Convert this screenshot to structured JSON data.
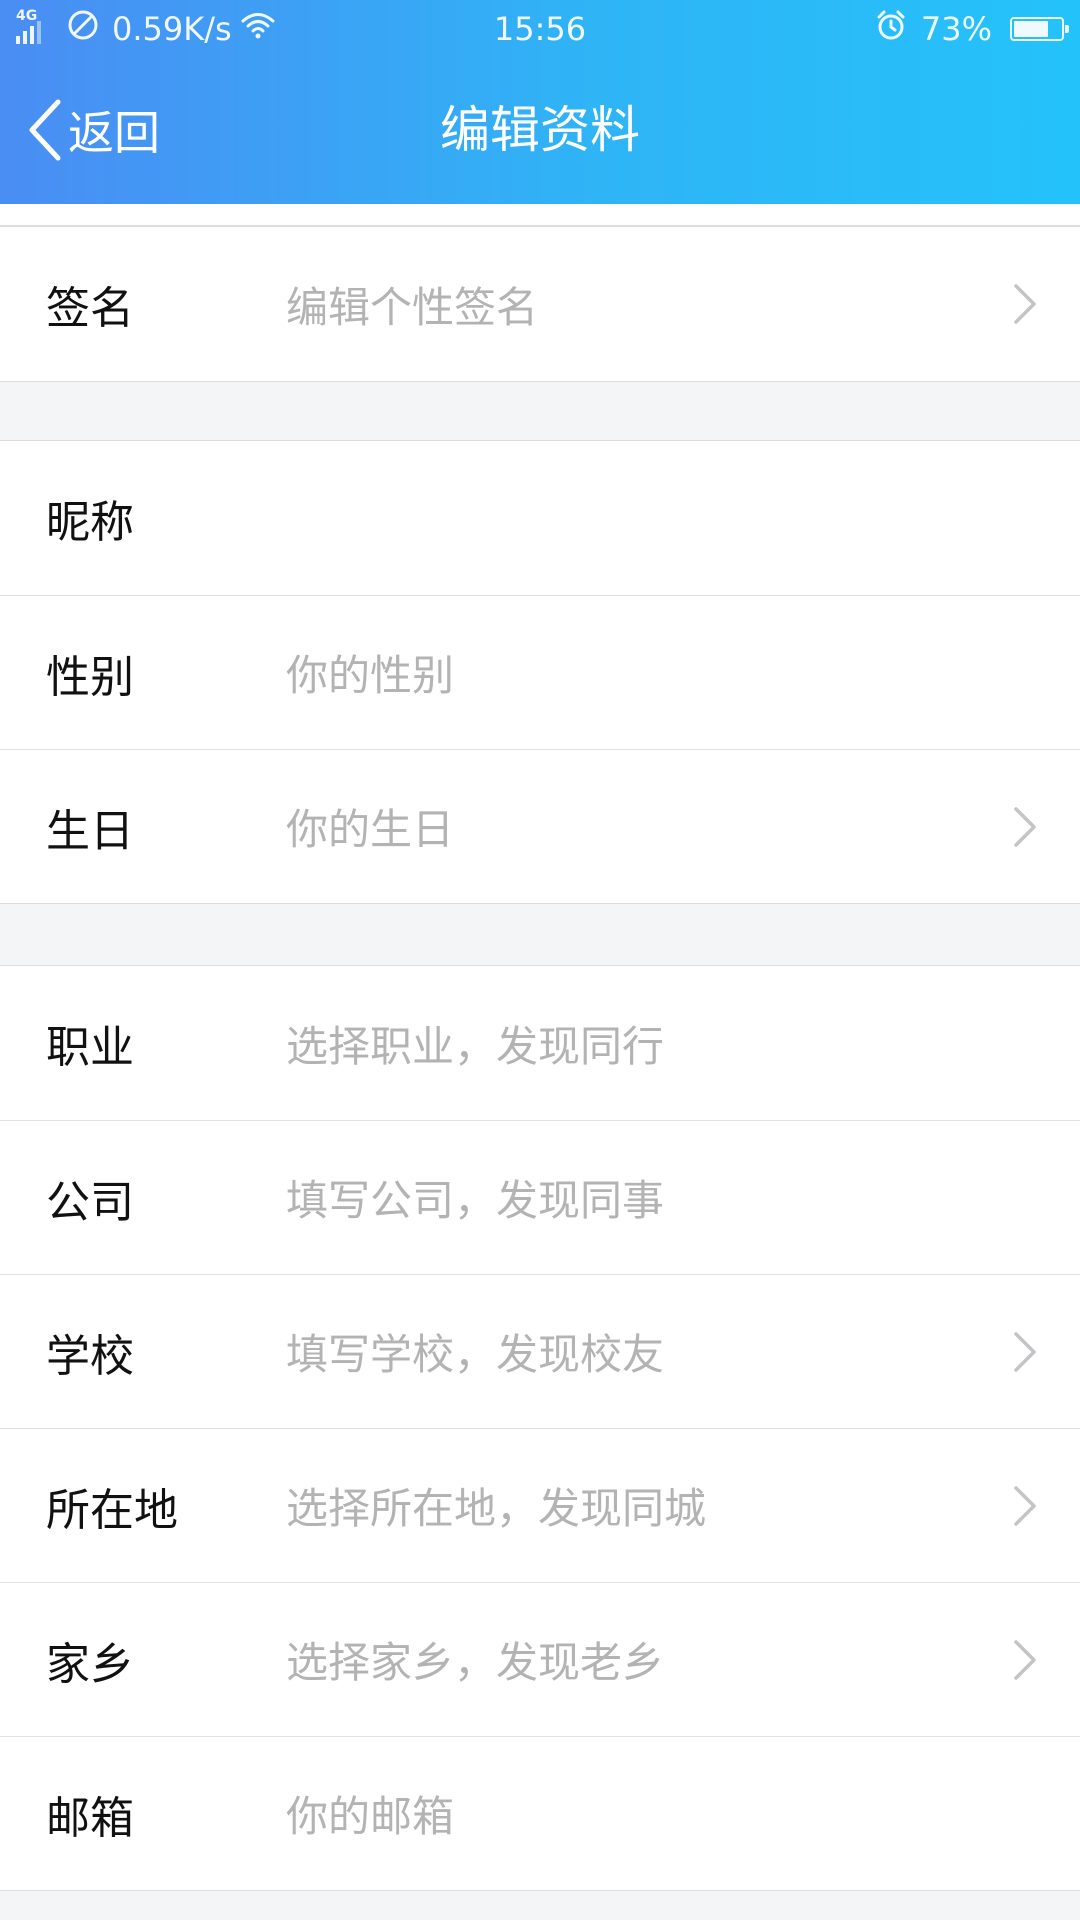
{
  "status_bar": {
    "network": "4G",
    "speed": "0.59K/s",
    "time": "15:56",
    "battery_percent": "73%",
    "battery_level": 0.73,
    "icons": [
      "signal-icon",
      "do-not-disturb-icon",
      "wifi-icon",
      "alarm-icon",
      "battery-icon"
    ]
  },
  "nav": {
    "back_label": "返回",
    "title": "编辑资料"
  },
  "colors": {
    "header_gradient_start": "#4a8df3",
    "header_gradient_end": "#24c2fb",
    "label": "#111111",
    "placeholder": "#b3b3b3",
    "background": "#f4f5f7"
  },
  "groups": [
    {
      "rows": [
        {
          "label": "签名",
          "value": "编辑个性签名",
          "chevron": true
        }
      ]
    },
    {
      "rows": [
        {
          "label": "昵称",
          "value": "",
          "chevron": false
        },
        {
          "label": "性别",
          "value": "你的性别",
          "chevron": false
        },
        {
          "label": "生日",
          "value": "你的生日",
          "chevron": true
        }
      ]
    },
    {
      "rows": [
        {
          "label": "职业",
          "value": "选择职业，发现同行",
          "chevron": false
        },
        {
          "label": "公司",
          "value": "填写公司，发现同事",
          "chevron": false
        },
        {
          "label": "学校",
          "value": "填写学校，发现校友",
          "chevron": true
        },
        {
          "label": "所在地",
          "value": "选择所在地，发现同城",
          "chevron": true
        },
        {
          "label": "家乡",
          "value": "选择家乡，发现老乡",
          "chevron": true
        },
        {
          "label": "邮箱",
          "value": "你的邮箱",
          "chevron": false
        }
      ]
    }
  ]
}
